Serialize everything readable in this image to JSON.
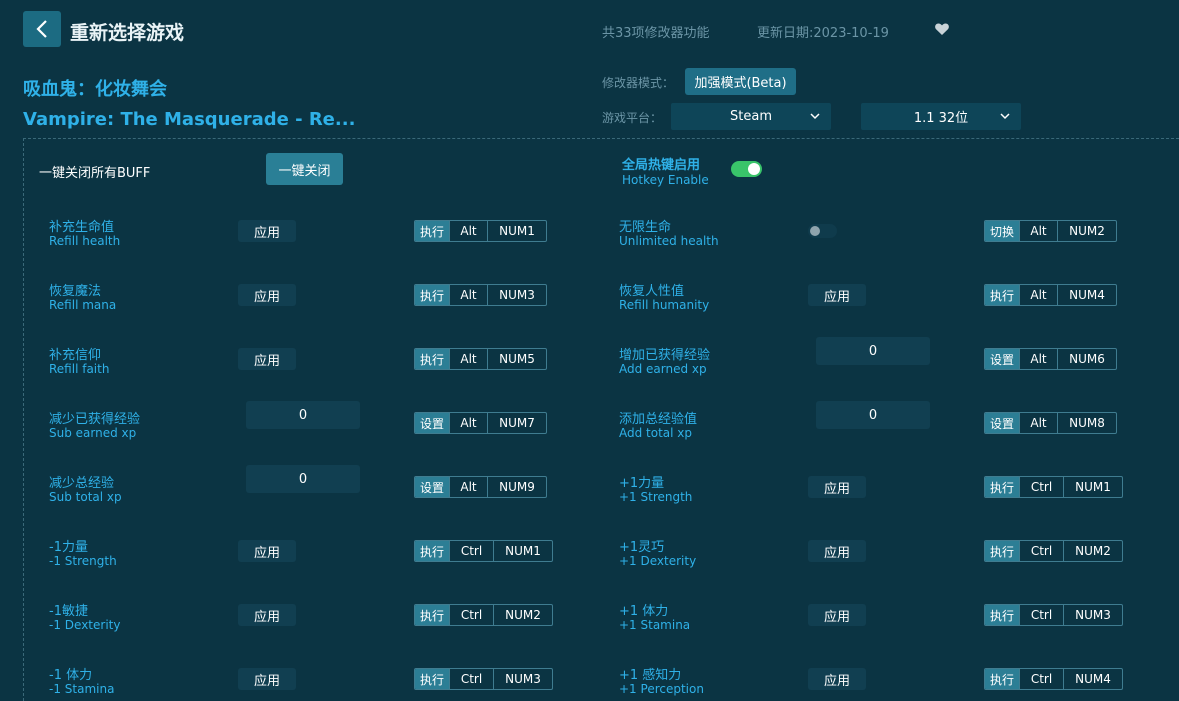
{
  "header": {
    "back_title": "重新选择游戏",
    "feature_count": "共33项修改器功能",
    "update_date": "更新日期:2023-10-19"
  },
  "game": {
    "title_cn": "吸血鬼：化妆舞会",
    "title_en": "Vampire: The Masquerade - Re..."
  },
  "settings": {
    "mode_label": "修改器模式：",
    "mode_value": "加强模式(Beta)",
    "platform_label": "游戏平台：",
    "platform_value": "Steam",
    "version_value": "1.1 32位"
  },
  "global": {
    "close_all_label": "一键关闭所有BUFF",
    "close_all_button": "一键关闭",
    "hotkey_cn": "全局热键启用",
    "hotkey_en": "Hotkey Enable",
    "hotkey_enabled": true
  },
  "features": {
    "left": [
      {
        "cn": "补充生命值",
        "en": "Refill health",
        "control": "apply",
        "label": "应用",
        "action": "执行",
        "mod": "Alt",
        "key": "NUM1"
      },
      {
        "cn": "恢复魔法",
        "en": "Refill mana",
        "control": "apply",
        "label": "应用",
        "action": "执行",
        "mod": "Alt",
        "key": "NUM3"
      },
      {
        "cn": "补充信仰",
        "en": "Refill faith",
        "control": "apply",
        "label": "应用",
        "action": "执行",
        "mod": "Alt",
        "key": "NUM5"
      },
      {
        "cn": "减少已获得经验",
        "en": "Sub earned xp",
        "control": "input",
        "value": "0",
        "action": "设置",
        "mod": "Alt",
        "key": "NUM7"
      },
      {
        "cn": "减少总经验",
        "en": "Sub total xp",
        "control": "input",
        "value": "0",
        "action": "设置",
        "mod": "Alt",
        "key": "NUM9"
      },
      {
        "cn": "-1力量",
        "en": "-1 Strength",
        "control": "apply",
        "label": "应用",
        "action": "执行",
        "mod": "Ctrl",
        "key": "NUM1"
      },
      {
        "cn": "-1敏捷",
        "en": "-1 Dexterity",
        "control": "apply",
        "label": "应用",
        "action": "执行",
        "mod": "Ctrl",
        "key": "NUM2"
      },
      {
        "cn": "-1 体力",
        "en": "-1 Stamina",
        "control": "apply",
        "label": "应用",
        "action": "执行",
        "mod": "Ctrl",
        "key": "NUM3"
      }
    ],
    "right": [
      {
        "cn": "无限生命",
        "en": "Unlimited health",
        "control": "toggle",
        "enabled": false,
        "action": "切换",
        "mod": "Alt",
        "key": "NUM2"
      },
      {
        "cn": "恢复人性值",
        "en": "Refill humanity",
        "control": "apply",
        "label": "应用",
        "action": "执行",
        "mod": "Alt",
        "key": "NUM4"
      },
      {
        "cn": "增加已获得经验",
        "en": "Add earned xp",
        "control": "input",
        "value": "0",
        "action": "设置",
        "mod": "Alt",
        "key": "NUM6"
      },
      {
        "cn": "添加总经验值",
        "en": "Add total xp",
        "control": "input",
        "value": "0",
        "action": "设置",
        "mod": "Alt",
        "key": "NUM8"
      },
      {
        "cn": "+1力量",
        "en": "+1 Strength",
        "control": "apply",
        "label": "应用",
        "action": "执行",
        "mod": "Ctrl",
        "key": "NUM1"
      },
      {
        "cn": "+1灵巧",
        "en": "+1 Dexterity",
        "control": "apply",
        "label": "应用",
        "action": "执行",
        "mod": "Ctrl",
        "key": "NUM2"
      },
      {
        "cn": "+1 体力",
        "en": "+1 Stamina",
        "control": "apply",
        "label": "应用",
        "action": "执行",
        "mod": "Ctrl",
        "key": "NUM3"
      },
      {
        "cn": "+1 感知力",
        "en": "+1 Perception",
        "control": "apply",
        "label": "应用",
        "action": "执行",
        "mod": "Ctrl",
        "key": "NUM4"
      }
    ]
  },
  "colors": {
    "background": "#0b3443",
    "accent_text": "#2fb1e8",
    "button": "#2a7f96",
    "toggle_on": "#39c46a"
  }
}
